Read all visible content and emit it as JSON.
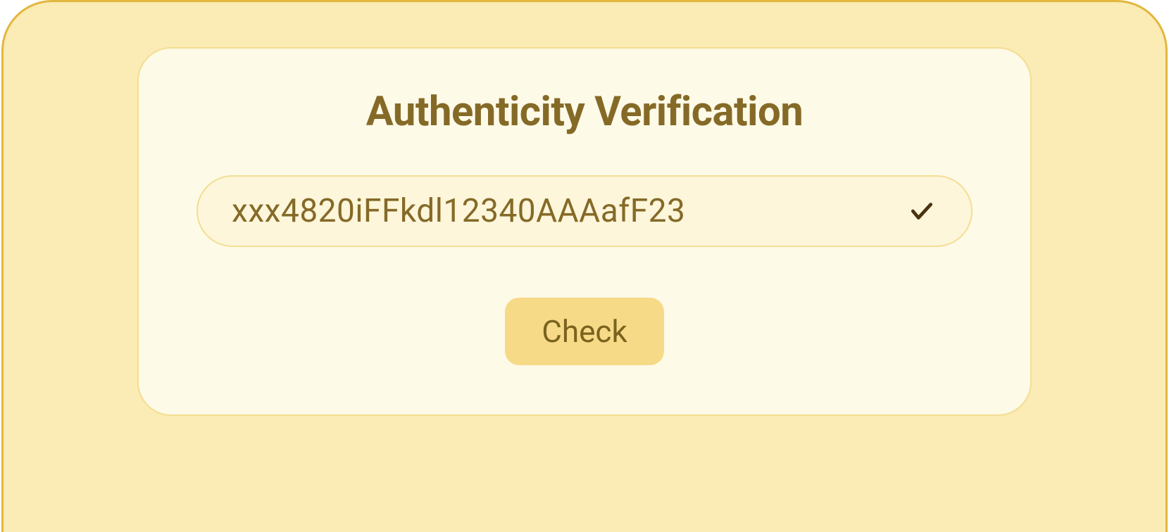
{
  "card": {
    "title": "Authenticity Verification",
    "code_value": "xxx4820iFFkdl12340AAAafF23",
    "code_placeholder": "",
    "check_button_label": "Check"
  },
  "colors": {
    "outer_bg": "#FBEBB4",
    "outer_border": "#E2B73E",
    "inner_bg": "#FEFAE8",
    "inner_border": "#F3DE92",
    "input_bg": "#FDF6DB",
    "text_primary": "#856A27",
    "button_bg": "#F6DA87",
    "icon_stroke": "#4A3210"
  }
}
